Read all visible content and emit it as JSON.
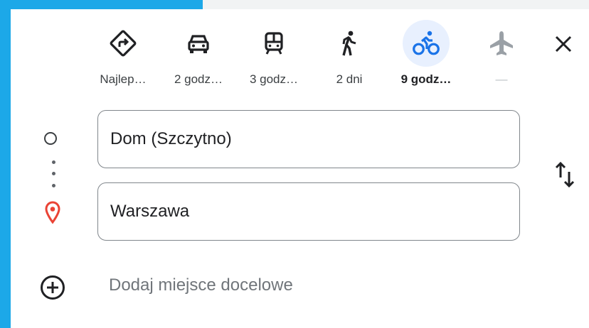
{
  "travel_modes": [
    {
      "name": "best",
      "label": "Najlep…"
    },
    {
      "name": "driving",
      "label": "2 godz…"
    },
    {
      "name": "transit",
      "label": "3 godz…"
    },
    {
      "name": "walking",
      "label": "2 dni"
    },
    {
      "name": "cycling",
      "label": "9 godz…",
      "selected": true
    },
    {
      "name": "flight",
      "label": "—",
      "disabled": true
    }
  ],
  "route": {
    "origin_value": "Dom (Szczytno)",
    "destination_value": "Warszawa"
  },
  "add_destination": {
    "label": "Dodaj miejsce docelowe"
  },
  "icons": {
    "best": "directions-icon",
    "driving": "car-icon",
    "transit": "train-icon",
    "walking": "walking-icon",
    "cycling": "bicycle-icon",
    "flight": "airplane-icon",
    "close": "close-icon",
    "swap": "swap-vertical-icon",
    "origin": "origin-circle-icon",
    "destination": "location-pin-icon",
    "add": "add-circle-icon"
  },
  "colors": {
    "accent_blue": "#1a73e8",
    "selected_bg": "#e8f0fe",
    "pin_red": "#ea4335",
    "frame_blue": "#1ca8e8"
  }
}
